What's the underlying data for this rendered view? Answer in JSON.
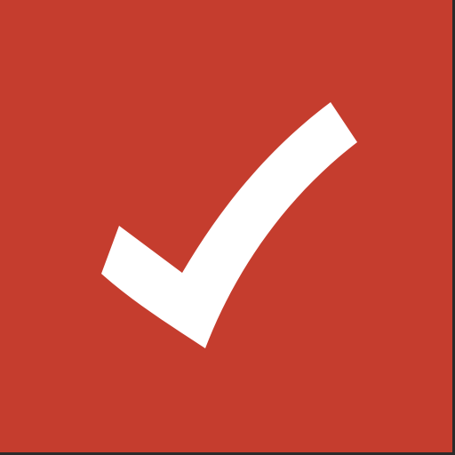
{
  "app_icon": {
    "icon": "checkmark-icon",
    "colors": {
      "background": "#c53d2e",
      "checkmark": "#ffffff",
      "frame": "#2b2b2b"
    }
  }
}
